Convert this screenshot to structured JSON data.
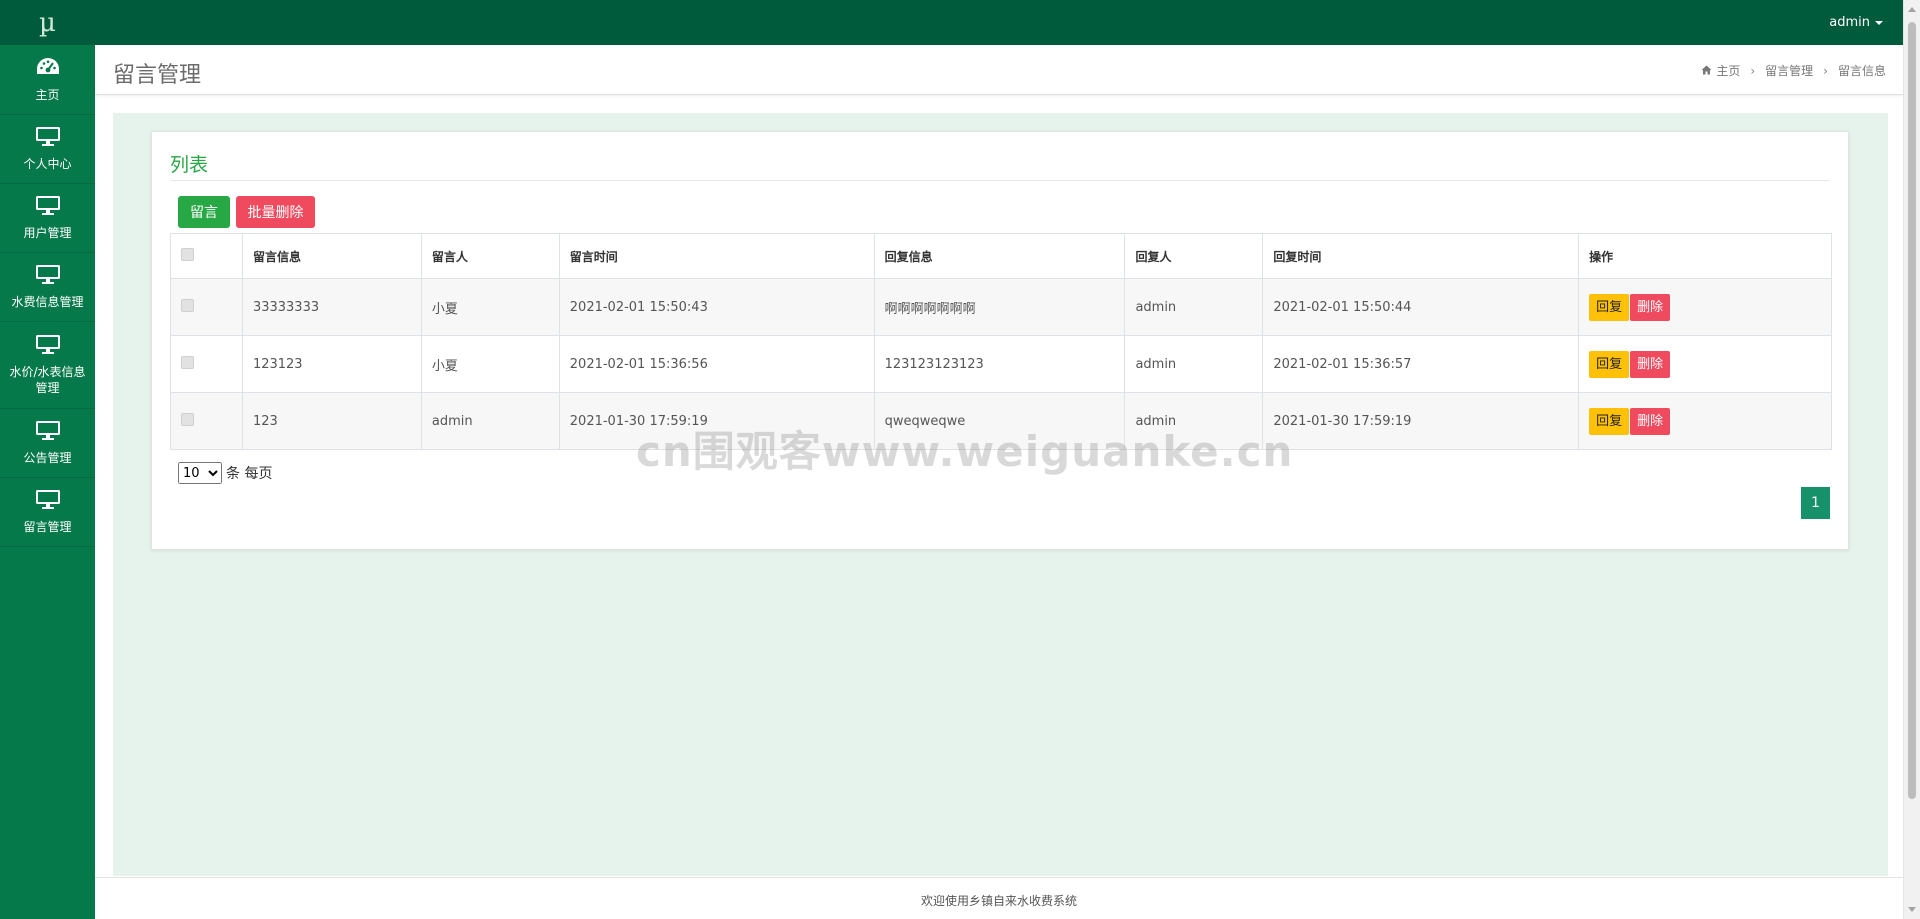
{
  "app": {
    "logo": "µ"
  },
  "sidebar": {
    "items": [
      {
        "label": "主页",
        "icon": "dashboard-icon"
      },
      {
        "label": "个人中心",
        "icon": "monitor-icon"
      },
      {
        "label": "用户管理",
        "icon": "monitor-icon"
      },
      {
        "label": "水费信息管理",
        "icon": "monitor-icon"
      },
      {
        "label": "水价/水表信息管理",
        "icon": "monitor-icon"
      },
      {
        "label": "公告管理",
        "icon": "monitor-icon"
      },
      {
        "label": "留言管理",
        "icon": "monitor-icon"
      }
    ]
  },
  "topbar": {
    "user": "admin"
  },
  "page": {
    "title": "留言管理",
    "breadcrumb": [
      "主页",
      "留言管理",
      "留言信息"
    ]
  },
  "panel": {
    "title": "列表",
    "add_button": "留言",
    "batch_delete_button": "批量删除"
  },
  "table": {
    "columns": [
      "留言信息",
      "留言人",
      "留言时间",
      "回复信息",
      "回复人",
      "回复时间",
      "操作"
    ],
    "rows": [
      {
        "message": "33333333",
        "author": "小夏",
        "time": "2021-02-01 15:50:43",
        "reply": "啊啊啊啊啊啊啊",
        "replier": "admin",
        "reply_time": "2021-02-01 15:50:44"
      },
      {
        "message": "123123",
        "author": "小夏",
        "time": "2021-02-01 15:36:56",
        "reply": "123123123123",
        "replier": "admin",
        "reply_time": "2021-02-01 15:36:57"
      },
      {
        "message": "123",
        "author": "admin",
        "time": "2021-01-30 17:59:19",
        "reply": "qweqweqwe",
        "replier": "admin",
        "reply_time": "2021-01-30 17:59:19"
      }
    ],
    "actions": {
      "reply": "回复",
      "delete": "删除"
    }
  },
  "pagination": {
    "page_size": "10",
    "page_size_suffix": "条 每页",
    "current_page": "1"
  },
  "watermark": "cn围观客www.weiguanke.cn",
  "footer": {
    "text": "欢迎使用乡镇自来水收费系统"
  },
  "colors": {
    "sidebar": "#06794a",
    "topbar": "#005a3c",
    "content_bg": "#e6f3ec",
    "primary_green": "#28a745",
    "danger": "#f04a5e",
    "warning": "#ffc107"
  }
}
